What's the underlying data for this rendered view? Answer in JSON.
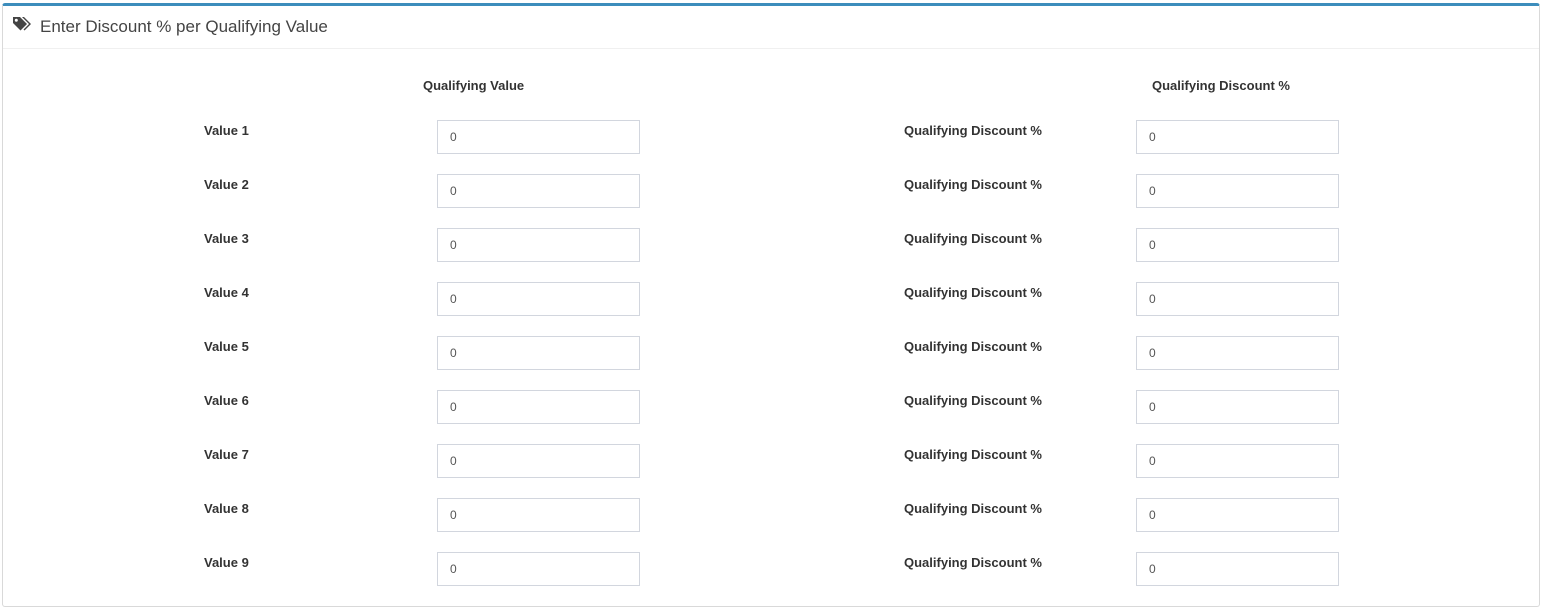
{
  "panel": {
    "icon": "tags-icon",
    "title": "Enter Discount % per Qualifying Value",
    "accent_color": "#3c8dbc"
  },
  "columns": {
    "left_header": "Qualifying Value",
    "right_header": "Qualifying Discount %"
  },
  "rows": [
    {
      "value_label": "Value 1",
      "value": "0",
      "discount_label": "Qualifying Discount %",
      "discount": "0"
    },
    {
      "value_label": "Value 2",
      "value": "0",
      "discount_label": "Qualifying Discount %",
      "discount": "0"
    },
    {
      "value_label": "Value 3",
      "value": "0",
      "discount_label": "Qualifying Discount %",
      "discount": "0"
    },
    {
      "value_label": "Value 4",
      "value": "0",
      "discount_label": "Qualifying Discount %",
      "discount": "0"
    },
    {
      "value_label": "Value 5",
      "value": "0",
      "discount_label": "Qualifying Discount %",
      "discount": "0"
    },
    {
      "value_label": "Value 6",
      "value": "0",
      "discount_label": "Qualifying Discount %",
      "discount": "0"
    },
    {
      "value_label": "Value 7",
      "value": "0",
      "discount_label": "Qualifying Discount %",
      "discount": "0"
    },
    {
      "value_label": "Value 8",
      "value": "0",
      "discount_label": "Qualifying Discount %",
      "discount": "0"
    },
    {
      "value_label": "Value 9",
      "value": "0",
      "discount_label": "Qualifying Discount %",
      "discount": "0"
    }
  ]
}
